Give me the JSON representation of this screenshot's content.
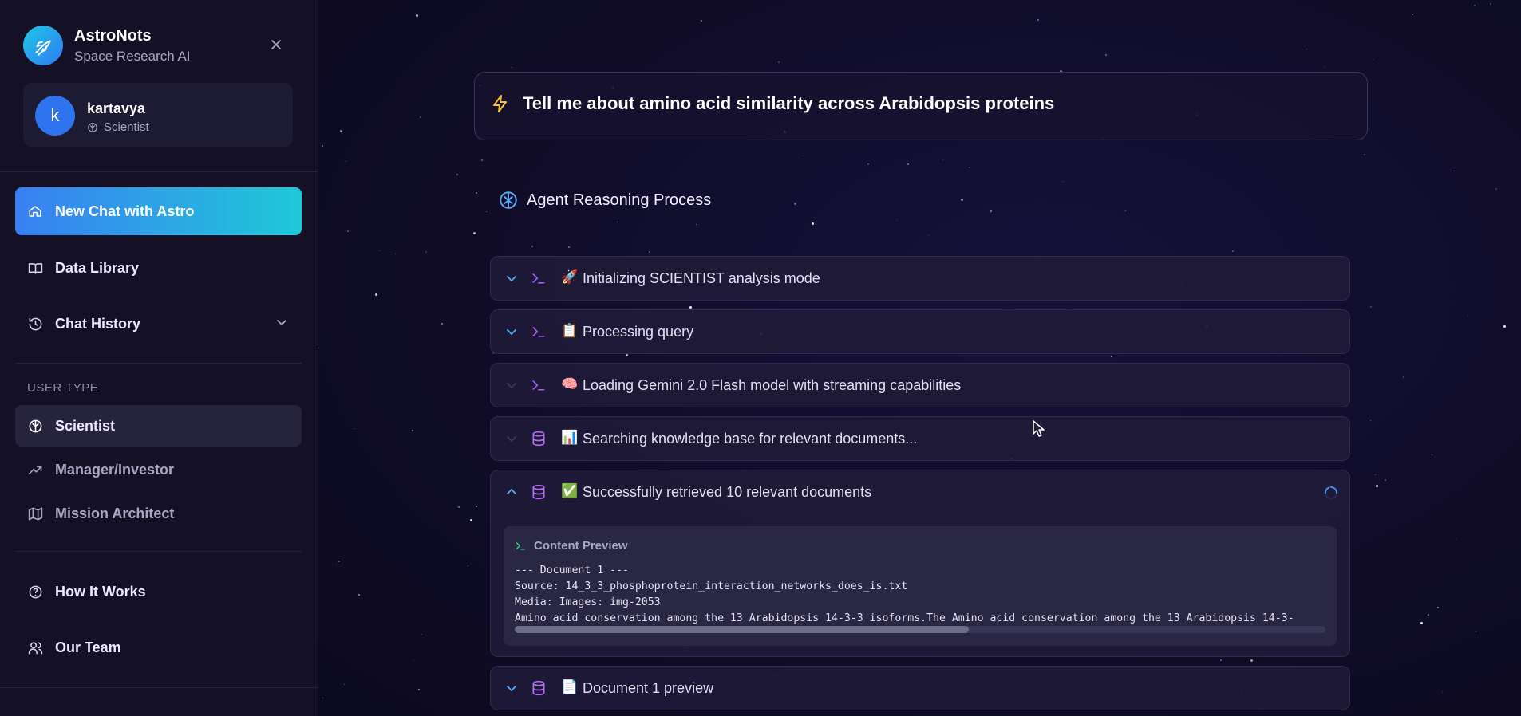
{
  "app": {
    "name": "AstroNots",
    "tagline": "Space Research AI"
  },
  "user": {
    "initial": "k",
    "name": "kartavya",
    "role": "Scientist"
  },
  "sidebar": {
    "new_chat": "New Chat with Astro",
    "data_library": "Data Library",
    "chat_history": "Chat History",
    "user_type_label": "USER TYPE",
    "user_types": [
      "Scientist",
      "Manager/Investor",
      "Mission Architect"
    ],
    "how_it_works": "How It Works",
    "our_team": "Our Team"
  },
  "query": {
    "text": "Tell me about amino acid similarity across Arabidopsis proteins"
  },
  "reasoning": {
    "title": "Agent Reasoning Process",
    "steps": [
      {
        "icon": "terminal-icon",
        "emoji": "🚀",
        "label": "Initializing SCIENTIST analysis mode"
      },
      {
        "icon": "terminal-icon",
        "emoji": "📋",
        "label": "Processing query"
      },
      {
        "icon": "terminal-icon",
        "emoji": "🧠",
        "label": "Loading Gemini 2.0 Flash model with streaming capabilities"
      },
      {
        "icon": "database-icon",
        "emoji": "📊",
        "label": "Searching knowledge base for relevant documents..."
      },
      {
        "icon": "database-icon",
        "emoji": "✅",
        "label": "Successfully retrieved 10 relevant documents"
      },
      {
        "icon": "database-icon",
        "emoji": "📄",
        "label": "Document 1 preview"
      }
    ],
    "preview": {
      "title": "Content Preview",
      "lines": [
        "--- Document 1 ---",
        "Source: 14_3_3_phosphoprotein_interaction_networks_does_is.txt",
        "Media: Images: img-2053",
        "Amino acid conservation among the 13 Arabidopsis 14-3-3 isoforms.The Amino acid conservation among the 13 Arabidopsis 14-3-"
      ],
      "scroll_fraction": 0.56
    }
  },
  "colors": {
    "accent_start": "#3a7ff2",
    "accent_end": "#1fc8d8",
    "terminal_icon": "#a35cf0",
    "database_icon": "#b46cf2",
    "bolt": "#f4c430"
  }
}
